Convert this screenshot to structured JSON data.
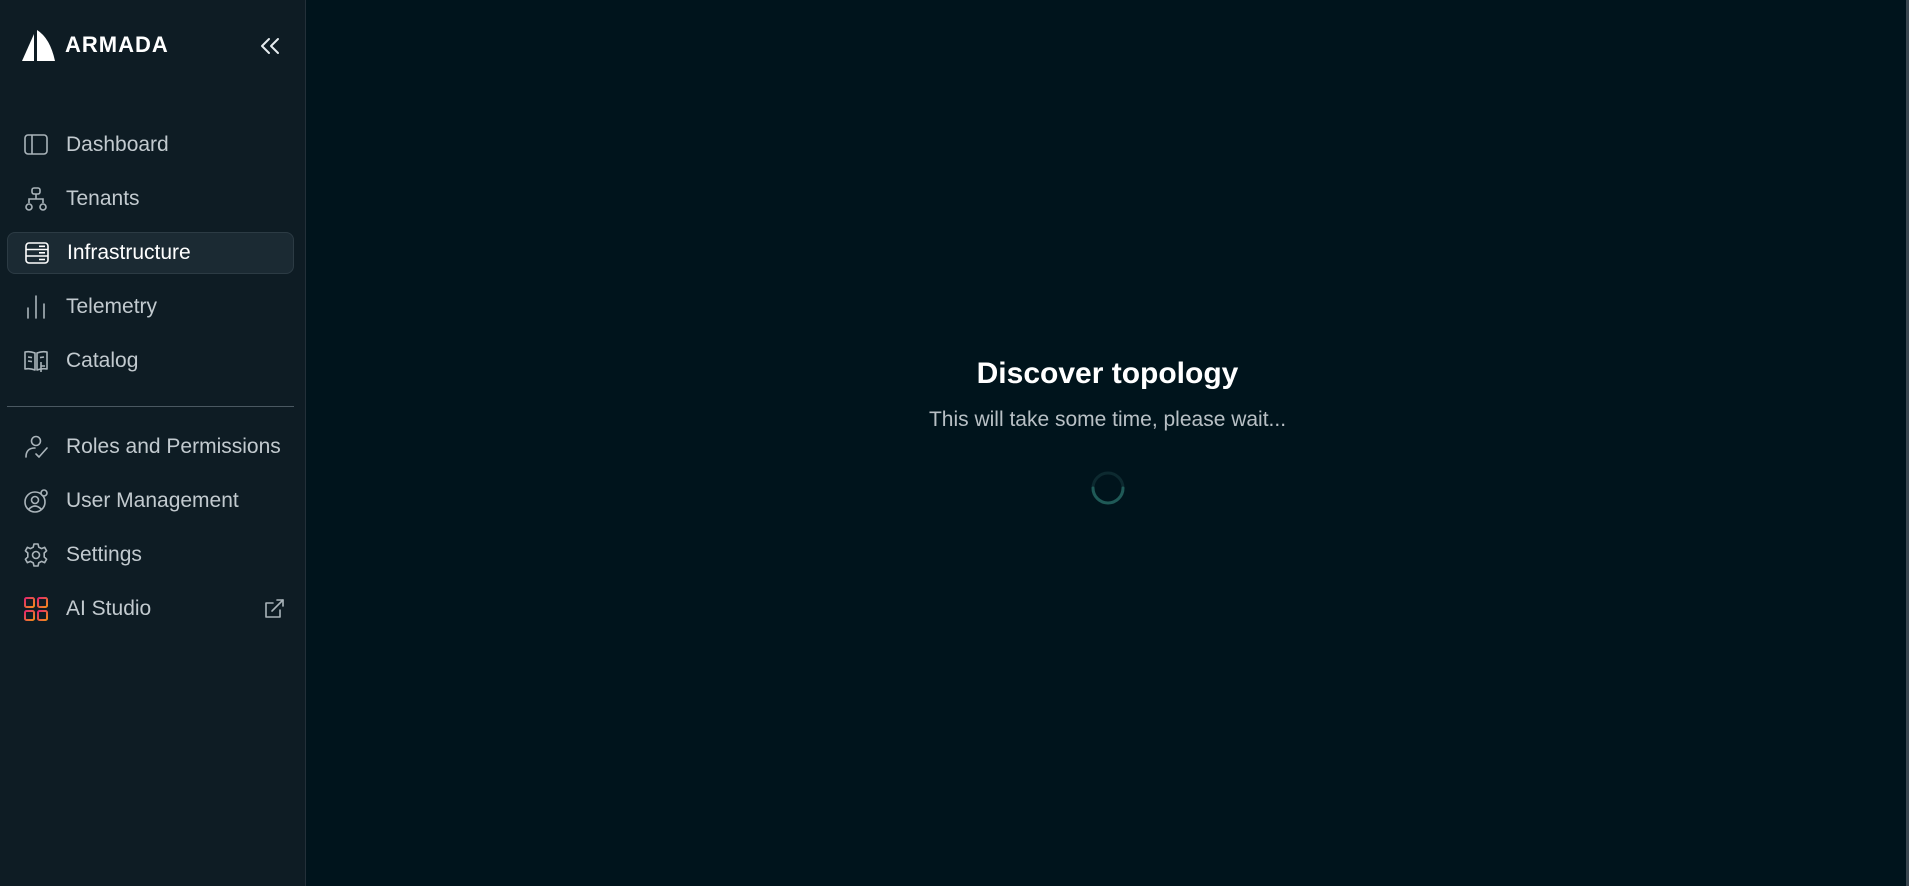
{
  "brand": {
    "name": "ARMADA"
  },
  "nav_primary": [
    {
      "label": "Dashboard",
      "icon": "dashboard-icon"
    },
    {
      "label": "Tenants",
      "icon": "tenants-icon"
    },
    {
      "label": "Infrastructure",
      "icon": "infrastructure-icon",
      "active": true
    },
    {
      "label": "Telemetry",
      "icon": "telemetry-icon"
    },
    {
      "label": "Catalog",
      "icon": "catalog-icon"
    }
  ],
  "nav_secondary": [
    {
      "label": "Roles and Permissions",
      "icon": "roles-icon"
    },
    {
      "label": "User Management",
      "icon": "user-management-icon"
    },
    {
      "label": "Settings",
      "icon": "gear-icon"
    },
    {
      "label": "AI Studio",
      "icon": "ai-studio-icon",
      "external": true
    }
  ],
  "main": {
    "title": "Discover topology",
    "subtitle": "This will take some time, please wait..."
  },
  "colors": {
    "sidebar_bg": "#0e1c24",
    "main_bg": "#00141c",
    "spinner": "#1f5a57",
    "ai_studio_gradient_start": "#e0286b",
    "ai_studio_gradient_end": "#f08a1c"
  }
}
